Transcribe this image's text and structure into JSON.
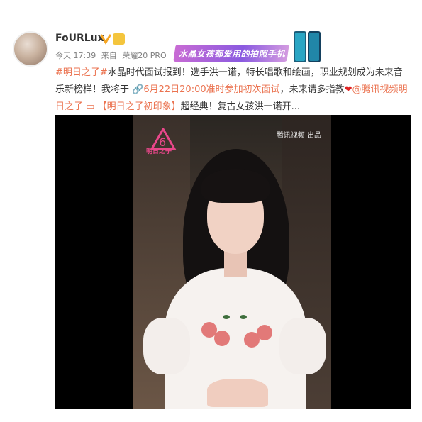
{
  "user": {
    "name": "FoURLux",
    "meta_time": "今天 17:39",
    "meta_from": "来自",
    "meta_device": "荣耀20 PRO"
  },
  "ad": {
    "text": "水晶女孩都爱用的拍照手机"
  },
  "post": {
    "tag": "#明日之子#",
    "text1": "水晶时代面试报到！选手洪一诺，特长唱歌和绘画，职业规划成为未来音乐新榜样！我将于",
    "event": "6月22日20:00准时参加初次面试",
    "text2": "，未来请多指教",
    "mention": "@腾讯视频明日之子",
    "quote": "【明日之子初印象】",
    "text3": "超经典！复古女孩洪一诺开..."
  },
  "video": {
    "logo_text": "明日之子",
    "watermark": "腾讯视频 出品"
  },
  "colors": {
    "link": "#eb7350",
    "heart": "#e02424",
    "logo": "#e8478a"
  },
  "icons": [
    "verified-icon",
    "level-badge-icon",
    "link-icon",
    "quote-icon",
    "heart-icon"
  ]
}
